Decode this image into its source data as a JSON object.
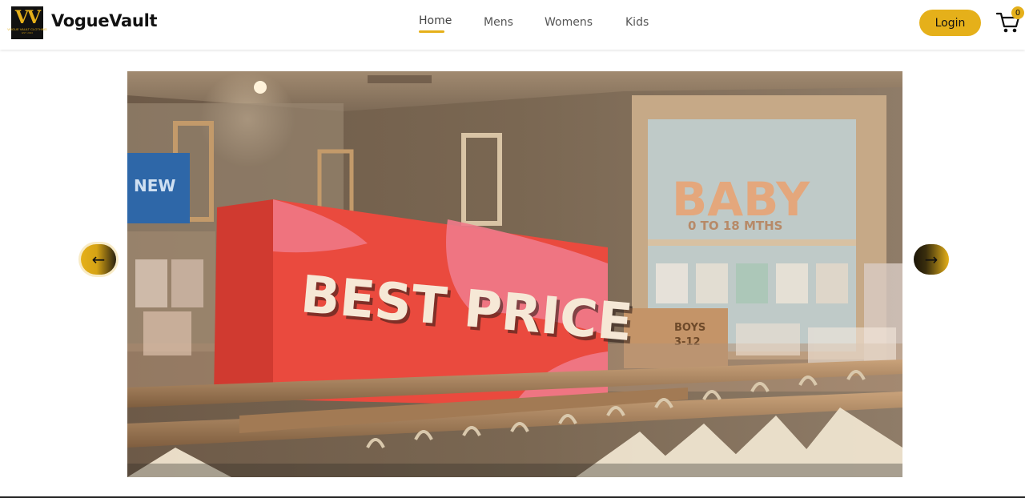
{
  "brand": {
    "name": "VogueVault",
    "logo_monogram": "VV",
    "logo_caption": "VOGUE VAULT CLOTHING",
    "logo_subcaption": "EST. 2024"
  },
  "nav": {
    "items": [
      {
        "label": "Home",
        "active": true
      },
      {
        "label": "Mens",
        "active": false
      },
      {
        "label": "Womens",
        "active": false
      },
      {
        "label": "Kids",
        "active": false
      }
    ]
  },
  "header": {
    "login_label": "Login",
    "cart_count": "0"
  },
  "carousel": {
    "prev_label": "←",
    "next_label": "→",
    "slide": {
      "sign_text": "BEST PRICE",
      "wall_sign": "BABY",
      "wall_subsign": "0 TO 18 MTHS",
      "new_sign": "NEW",
      "boys_sign_1": "BOYS",
      "boys_sign_2": "3-12"
    }
  },
  "colors": {
    "accent": "#e5b01a",
    "sign_red": "#e8433a",
    "sign_pink": "#f07a8a"
  }
}
